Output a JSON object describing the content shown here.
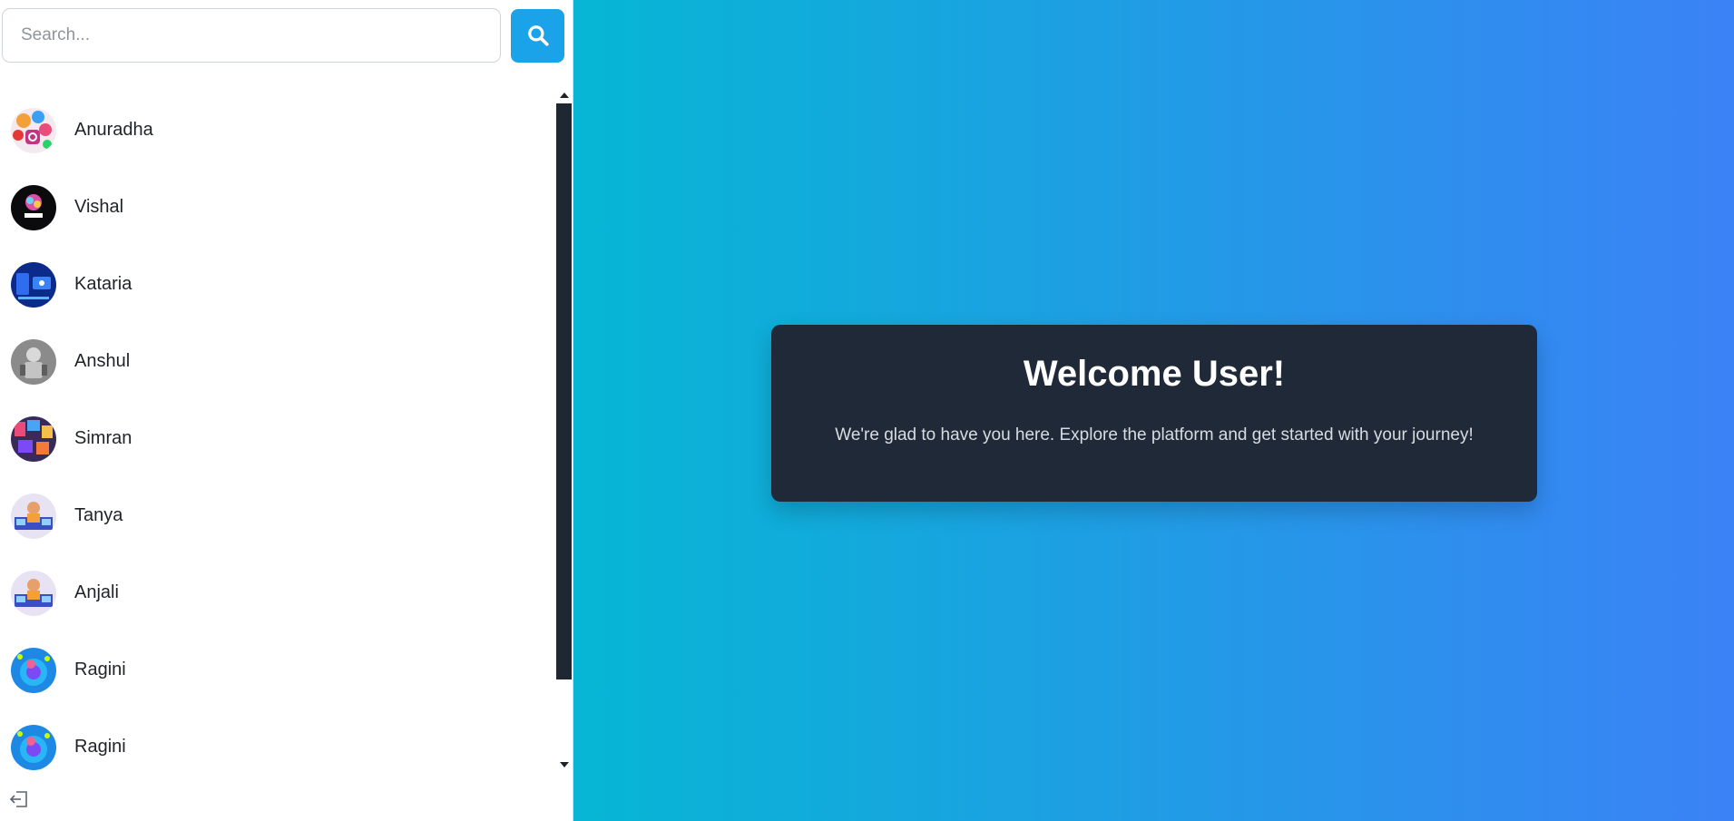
{
  "search": {
    "placeholder": "Search...",
    "button_icon": "search-icon"
  },
  "users": [
    {
      "name": "Anuradha",
      "avatar": "social-apps-avatar"
    },
    {
      "name": "Vishal",
      "avatar": "tars-logo-avatar"
    },
    {
      "name": "Kataria",
      "avatar": "app-screen-avatar"
    },
    {
      "name": "Anshul",
      "avatar": "robot-avatar"
    },
    {
      "name": "Simran",
      "avatar": "colorful-collage-avatar"
    },
    {
      "name": "Tanya",
      "avatar": "developer-desk-avatar"
    },
    {
      "name": "Anjali",
      "avatar": "developer-desk-avatar"
    },
    {
      "name": "Ragini",
      "avatar": "globe-illustration-avatar"
    },
    {
      "name": "Ragini",
      "avatar": "globe-illustration-avatar"
    }
  ],
  "sidebar_footer": {
    "logout_icon": "logout-icon"
  },
  "welcome": {
    "title": "Welcome User!",
    "message": "We're glad to have you here. Explore the platform and get started with your journey!"
  },
  "colors": {
    "accent": "#1aa3e8",
    "card_bg": "#1f2937",
    "gradient_start": "#06b6d4",
    "gradient_end": "#3b82f6"
  }
}
